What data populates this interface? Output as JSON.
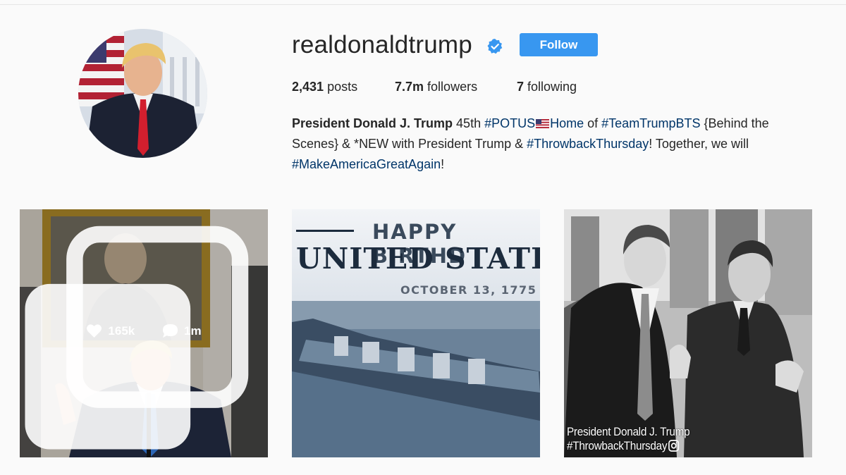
{
  "profile": {
    "username": "realdonaldtrump",
    "verified": true,
    "follow_label": "Follow",
    "stats": {
      "posts_count": "2,431",
      "posts_label": "posts",
      "followers_count": "7.7m",
      "followers_label": "followers",
      "following_count": "7",
      "following_label": "following"
    },
    "bio": {
      "name": "President Donald J. Trump",
      "t1": " 45th ",
      "tag_potus": "#POTUS",
      "t2": "Home",
      "t3": " of ",
      "tag_bts": "#TeamTrumpBTS",
      "t4": " {Behind the Scenes} & *NEW with President Trump & ",
      "tag_tbt": "#ThrowbackThursday",
      "t5": "! Together, we will ",
      "tag_maga": "#MakeAmericaGreatAgain",
      "t6": "!"
    }
  },
  "posts": [
    {
      "likes": "165k",
      "comments": "1m",
      "multi": true
    },
    {
      "banner_line1": "HAPPY BIRTHD",
      "banner_line2": "UNITED STATES",
      "banner_line3": "OCTOBER 13, 1775"
    },
    {
      "caption_line1": "President Donald J. Trump",
      "caption_line2": "#ThrowbackThursday"
    }
  ],
  "colors": {
    "accent": "#3897f0",
    "hashtag": "#003569",
    "background": "#fafafa"
  },
  "icons": [
    "verified-badge-icon",
    "heart-icon",
    "comment-icon",
    "multiple-photos-icon",
    "instagram-icon",
    "us-flag-icon"
  ]
}
